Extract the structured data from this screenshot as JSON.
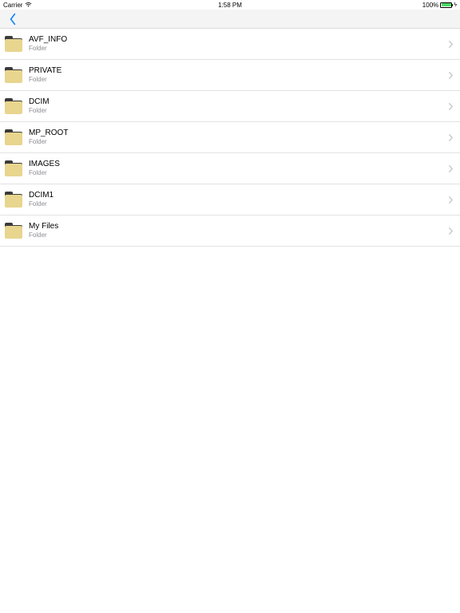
{
  "status": {
    "carrier": "Carrier",
    "time": "1:58 PM",
    "battery_pct": "100%"
  },
  "items": [
    {
      "name": "AVF_INFO",
      "type": "Folder"
    },
    {
      "name": "PRIVATE",
      "type": "Folder"
    },
    {
      "name": "DCIM",
      "type": "Folder"
    },
    {
      "name": "MP_ROOT",
      "type": "Folder"
    },
    {
      "name": "IMAGES",
      "type": "Folder"
    },
    {
      "name": "DCIM1",
      "type": "Folder"
    },
    {
      "name": "My Files",
      "type": "Folder"
    }
  ]
}
